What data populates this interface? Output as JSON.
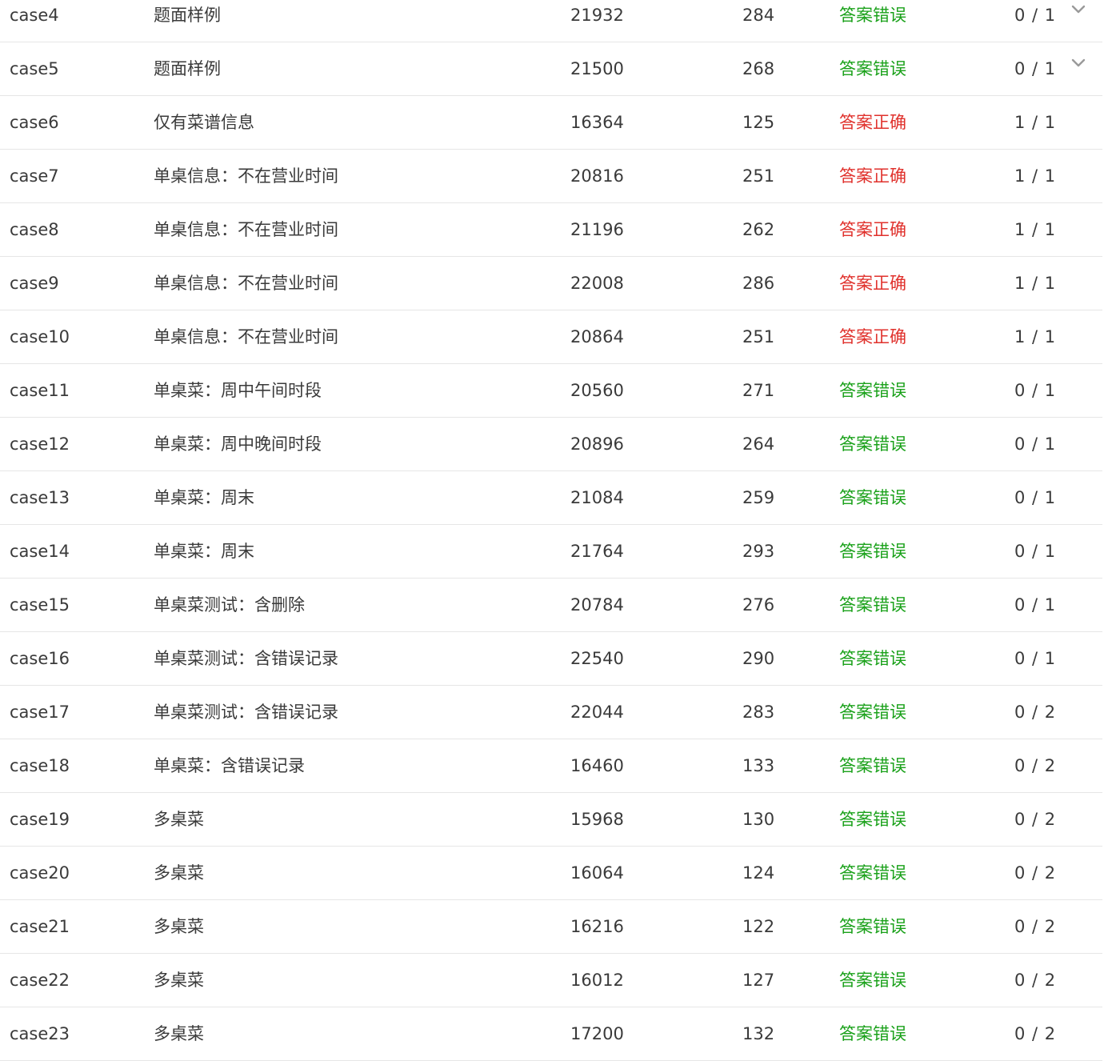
{
  "colors": {
    "wrong": "#1aa11a",
    "right": "#e0312c",
    "text": "#3a3a3a",
    "divider": "#e6e6e6",
    "chevron": "#9a9a9a"
  },
  "rows": [
    {
      "id": "case4",
      "name": "题面样例",
      "memory": "21932",
      "time": "284",
      "result": "答案错误",
      "status": "wrong",
      "score": "0 / 1",
      "expandable": true,
      "expand_icon": "chevron-down-icon"
    },
    {
      "id": "case5",
      "name": "题面样例",
      "memory": "21500",
      "time": "268",
      "result": "答案错误",
      "status": "wrong",
      "score": "0 / 1",
      "expandable": true,
      "expand_icon": "chevron-down-icon"
    },
    {
      "id": "case6",
      "name": "仅有菜谱信息",
      "memory": "16364",
      "time": "125",
      "result": "答案正确",
      "status": "right",
      "score": "1 / 1",
      "expandable": false
    },
    {
      "id": "case7",
      "name": "单桌信息：不在营业时间",
      "memory": "20816",
      "time": "251",
      "result": "答案正确",
      "status": "right",
      "score": "1 / 1",
      "expandable": false
    },
    {
      "id": "case8",
      "name": "单桌信息：不在营业时间",
      "memory": "21196",
      "time": "262",
      "result": "答案正确",
      "status": "right",
      "score": "1 / 1",
      "expandable": false
    },
    {
      "id": "case9",
      "name": "单桌信息：不在营业时间",
      "memory": "22008",
      "time": "286",
      "result": "答案正确",
      "status": "right",
      "score": "1 / 1",
      "expandable": false
    },
    {
      "id": "case10",
      "name": "单桌信息：不在营业时间",
      "memory": "20864",
      "time": "251",
      "result": "答案正确",
      "status": "right",
      "score": "1 / 1",
      "expandable": false
    },
    {
      "id": "case11",
      "name": "单桌菜：周中午间时段",
      "memory": "20560",
      "time": "271",
      "result": "答案错误",
      "status": "wrong",
      "score": "0 / 1",
      "expandable": false
    },
    {
      "id": "case12",
      "name": "单桌菜：周中晚间时段",
      "memory": "20896",
      "time": "264",
      "result": "答案错误",
      "status": "wrong",
      "score": "0 / 1",
      "expandable": false
    },
    {
      "id": "case13",
      "name": "单桌菜：周末",
      "memory": "21084",
      "time": "259",
      "result": "答案错误",
      "status": "wrong",
      "score": "0 / 1",
      "expandable": false
    },
    {
      "id": "case14",
      "name": "单桌菜：周末",
      "memory": "21764",
      "time": "293",
      "result": "答案错误",
      "status": "wrong",
      "score": "0 / 1",
      "expandable": false
    },
    {
      "id": "case15",
      "name": "单桌菜测试：含删除",
      "memory": "20784",
      "time": "276",
      "result": "答案错误",
      "status": "wrong",
      "score": "0 / 1",
      "expandable": false
    },
    {
      "id": "case16",
      "name": "单桌菜测试：含错误记录",
      "memory": "22540",
      "time": "290",
      "result": "答案错误",
      "status": "wrong",
      "score": "0 / 1",
      "expandable": false
    },
    {
      "id": "case17",
      "name": "单桌菜测试：含错误记录",
      "memory": "22044",
      "time": "283",
      "result": "答案错误",
      "status": "wrong",
      "score": "0 / 2",
      "expandable": false
    },
    {
      "id": "case18",
      "name": "单桌菜：含错误记录",
      "memory": "16460",
      "time": "133",
      "result": "答案错误",
      "status": "wrong",
      "score": "0 / 2",
      "expandable": false
    },
    {
      "id": "case19",
      "name": "多桌菜",
      "memory": "15968",
      "time": "130",
      "result": "答案错误",
      "status": "wrong",
      "score": "0 / 2",
      "expandable": false
    },
    {
      "id": "case20",
      "name": "多桌菜",
      "memory": "16064",
      "time": "124",
      "result": "答案错误",
      "status": "wrong",
      "score": "0 / 2",
      "expandable": false
    },
    {
      "id": "case21",
      "name": "多桌菜",
      "memory": "16216",
      "time": "122",
      "result": "答案错误",
      "status": "wrong",
      "score": "0 / 2",
      "expandable": false
    },
    {
      "id": "case22",
      "name": "多桌菜",
      "memory": "16012",
      "time": "127",
      "result": "答案错误",
      "status": "wrong",
      "score": "0 / 2",
      "expandable": false
    },
    {
      "id": "case23",
      "name": "多桌菜",
      "memory": "17200",
      "time": "132",
      "result": "答案错误",
      "status": "wrong",
      "score": "0 / 2",
      "expandable": false
    }
  ]
}
